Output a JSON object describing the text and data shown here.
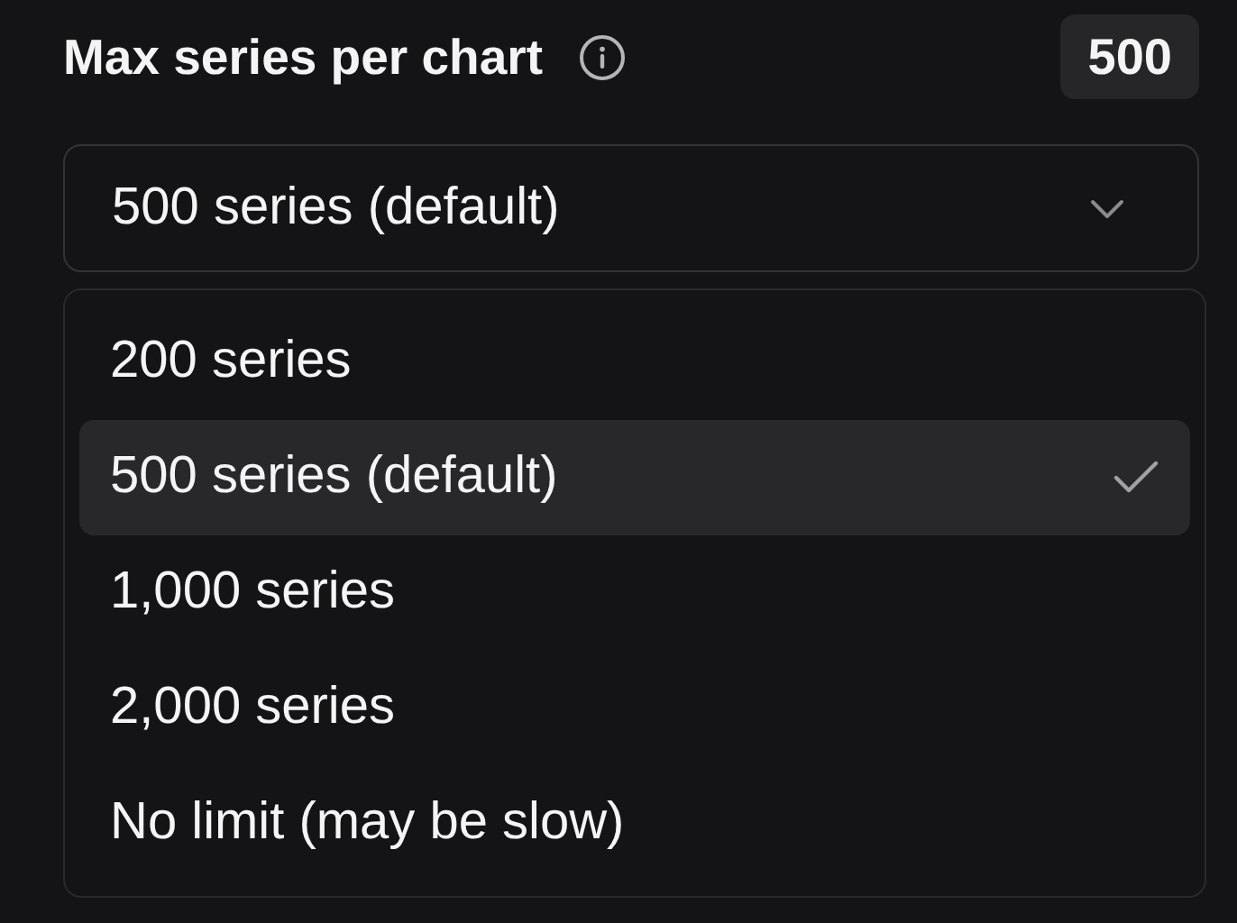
{
  "setting": {
    "label": "Max series per chart",
    "value": "500"
  },
  "select": {
    "value": "500 series (default)",
    "expanded": true
  },
  "options": [
    {
      "label": "200 series",
      "selected": false
    },
    {
      "label": "500 series (default)",
      "selected": true
    },
    {
      "label": "1,000 series",
      "selected": false
    },
    {
      "label": "2,000 series",
      "selected": false
    },
    {
      "label": "No limit (may be slow)",
      "selected": false
    }
  ]
}
